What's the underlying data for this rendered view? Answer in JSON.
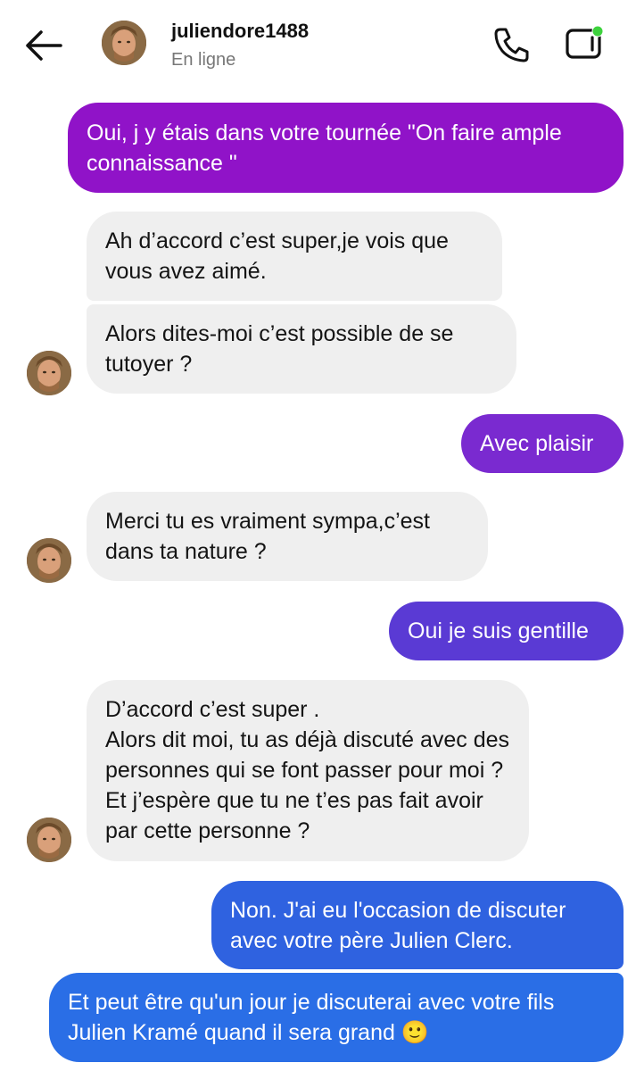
{
  "header": {
    "username": "juliendore1488",
    "status": "En ligne",
    "online_dot_color": "#3dd23d"
  },
  "messages": [
    {
      "from": "me",
      "text": "Oui, j y étais dans votre tournée \"On faire ample connaissance \"",
      "color": "#9013c8"
    },
    {
      "from": "contact",
      "text": "Ah d’accord c’est super,je vois que vous avez aimé."
    },
    {
      "from": "contact",
      "text": "Alors dites-moi c’est possible de se tutoyer ?"
    },
    {
      "from": "me",
      "text": "Avec plaisir",
      "color": "#7a2ad0"
    },
    {
      "from": "contact",
      "text": "Merci tu es vraiment sympa,c’est dans ta nature ?"
    },
    {
      "from": "me",
      "text": "Oui je suis gentille",
      "color": "#5a3ad4"
    },
    {
      "from": "contact",
      "text": "D’accord c’est super .\nAlors dit moi, tu as déjà discuté avec des personnes qui se font passer pour moi ? Et j’espère que tu ne t’es pas fait avoir par cette personne ?"
    },
    {
      "from": "me",
      "text": "Non. J'ai eu l'occasion de discuter avec votre père Julien Clerc.",
      "color": "#2f62e0"
    },
    {
      "from": "me",
      "text": "Et peut être qu'un jour je discuterai avec votre fils Julien Kramé quand il sera grand 🙂",
      "color": "#2a6ee6"
    }
  ],
  "icons": {
    "back": "arrow-left-icon",
    "call": "phone-icon",
    "video": "video-camera-icon"
  }
}
